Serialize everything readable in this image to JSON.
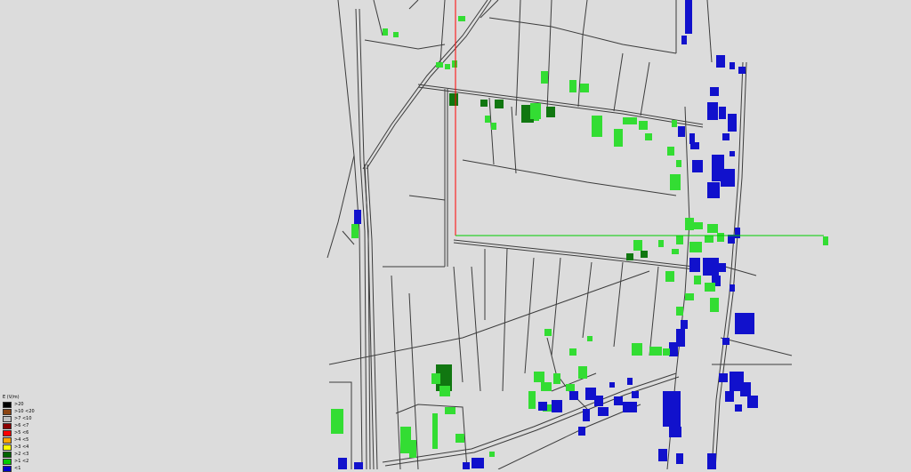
{
  "map": {
    "background_color": "#dcdcdc",
    "road_color": "#3c3c3c",
    "marker_colors": {
      "vertical": "#ff0000",
      "horizontal": "#00cc00"
    }
  },
  "legend": {
    "title": "E (V/m)",
    "items": [
      {
        "label": ">20",
        "color": "#000000"
      },
      {
        "label": ">10  <20",
        "color": "#8b4513"
      },
      {
        "label": ">7   <10",
        "color": "#c0c0c0"
      },
      {
        "label": ">6   <7",
        "color": "#8b0000"
      },
      {
        "label": ">5   <6",
        "color": "#ff0000"
      },
      {
        "label": ">4   <5",
        "color": "#ffa500"
      },
      {
        "label": ">3   <4",
        "color": "#ffff00"
      },
      {
        "label": ">2   <3",
        "color": "#006400"
      },
      {
        "label": ">1   <2",
        "color": "#00cc00"
      },
      {
        "label": "<1",
        "color": "#0000cc"
      }
    ]
  }
}
